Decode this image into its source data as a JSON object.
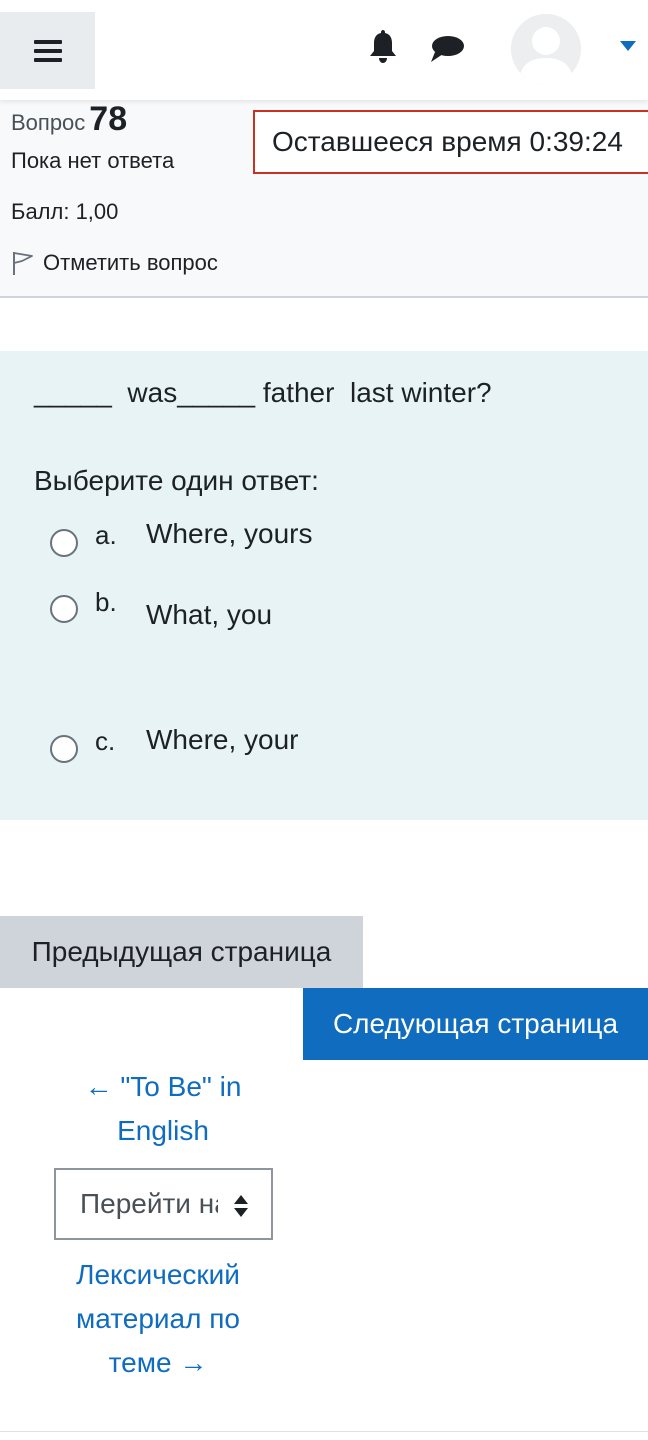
{
  "header": {
    "menu_icon": "hamburger-icon",
    "notifications_icon": "bell-icon",
    "messages_icon": "chat-bubble-icon",
    "user_icon": "avatar-placeholder",
    "user_menu_icon": "caret-down-icon",
    "accent_color": "#0f6cbf"
  },
  "info": {
    "question_label": "Вопрос",
    "question_number": "78",
    "state": "Пока нет ответа",
    "grade": "Балл: 1,00",
    "flag_label": "Отметить вопрос"
  },
  "timer": {
    "text": "Оставшееся время 0:39:24"
  },
  "question": {
    "text": "_____  was_____ father  last winter?",
    "prompt": "Выберите один ответ:",
    "options": [
      {
        "letter": "a.",
        "text": "Where, yours"
      },
      {
        "letter": "b.",
        "text": "What, you"
      },
      {
        "letter": "c.",
        "text": "Where, your"
      }
    ]
  },
  "navigation": {
    "prev_button": "Предыдущая страница",
    "next_button": "Следующая страница"
  },
  "activity_nav": {
    "prev_link_line1": "← \"To Be\" in",
    "prev_link_line2": "English",
    "jump_select": "Перейти на...",
    "next_link_line1": "Лексический",
    "next_link_line2": "материал по",
    "next_link_line3": "теме →"
  }
}
